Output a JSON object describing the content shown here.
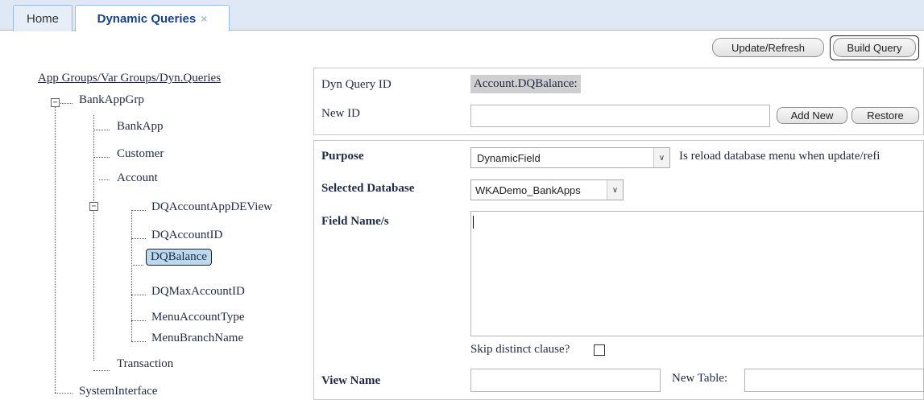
{
  "tabs": [
    {
      "label": "Home"
    },
    {
      "label": "Dynamic Queries",
      "close": "×"
    }
  ],
  "toolbar": {
    "update_refresh": "Update/Refresh",
    "build_query": "Build Query"
  },
  "tree": {
    "root_label": "App Groups/Var Groups/Dyn.Queries",
    "bankappgrp": "BankAppGrp",
    "bankapp": "BankApp",
    "customer": "Customer",
    "account": "Account",
    "dq_account_appde_view": "DQAccountAppDEView",
    "dq_account_id": "DQAccountID",
    "dq_balance": "DQBalance",
    "dq_max_account_id": "DQMaxAccountID",
    "menu_account_type": "MenuAccountType",
    "menu_branch_name": "MenuBranchName",
    "transaction": "Transaction",
    "system_interface": "SystemInterface",
    "expander_symbol": "−"
  },
  "form": {
    "dyn_query_id_label": "Dyn Query ID",
    "dyn_query_id_value": "Account.DQBalance:",
    "new_id_label": "New ID",
    "new_id_value": "",
    "add_new": "Add New",
    "restore": "Restore",
    "purpose_label": "Purpose",
    "purpose_value": "DynamicField",
    "reload_text": "Is reload database menu when update/refi",
    "selected_database_label": "Selected Database",
    "selected_database_value": "WKADemo_BankApps",
    "field_names_label": "Field Name/s",
    "field_names_value": "",
    "skip_distinct_label": "Skip distinct clause?",
    "skip_distinct_checked": false,
    "view_name_label": "View Name",
    "view_name_value": "",
    "new_table_label": "New Table:",
    "new_table_value": "",
    "dropdown_icon": "chevron-down-icon"
  }
}
